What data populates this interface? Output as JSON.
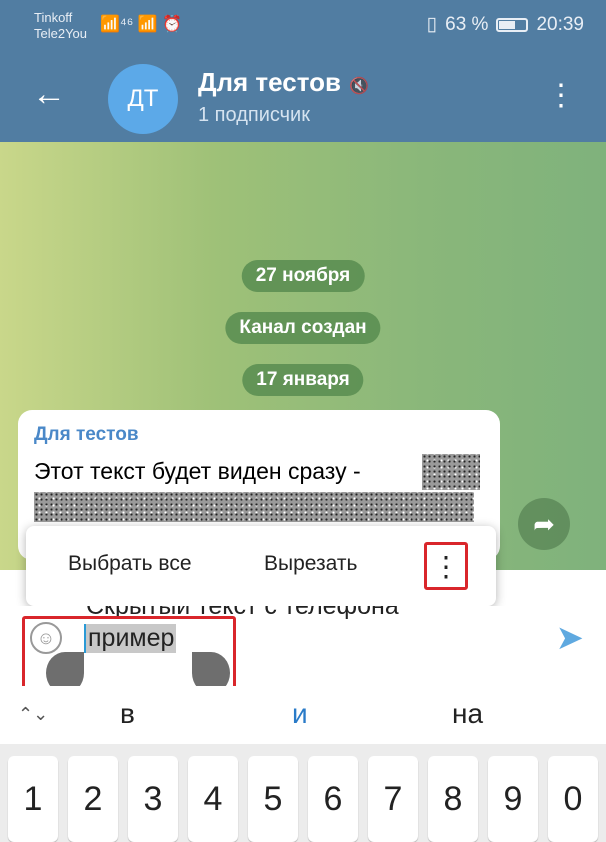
{
  "status_bar": {
    "carrier1": "Tinkoff",
    "carrier2": "Tele2You",
    "signal_icons": "📶⁴⁶ 📶 ⏰",
    "vibrate_icon": "▯",
    "battery": "63 %",
    "battery_level": 0.63,
    "time": "20:39"
  },
  "header": {
    "back_icon": "←",
    "avatar_initials": "ДТ",
    "title": "Для тестов",
    "mute_icon": "🔇",
    "subtitle": "1 подписчик",
    "menu_icon": "⋮",
    "color": "#517da2"
  },
  "chat": {
    "date1": "27 ноября",
    "service": "Канал создан",
    "date2": "17 января",
    "message": {
      "author": "Для тестов",
      "text": "Этот текст будет виден сразу -"
    },
    "share_icon": "➦"
  },
  "context_menu": {
    "select_all": "Выбрать все",
    "cut": "Вырезать",
    "more_icon": "⋮"
  },
  "input": {
    "hidden_line": "Скрытый текст с телефона",
    "selected_text": "пример",
    "emoji_icon": "☺",
    "send_icon": "➤"
  },
  "suggestions": {
    "expand_icon": "⌃⌄",
    "items": [
      "в",
      "и",
      "на"
    ]
  },
  "keyboard": {
    "keys": [
      "1",
      "2",
      "3",
      "4",
      "5",
      "6",
      "7",
      "8",
      "9",
      "0"
    ]
  }
}
